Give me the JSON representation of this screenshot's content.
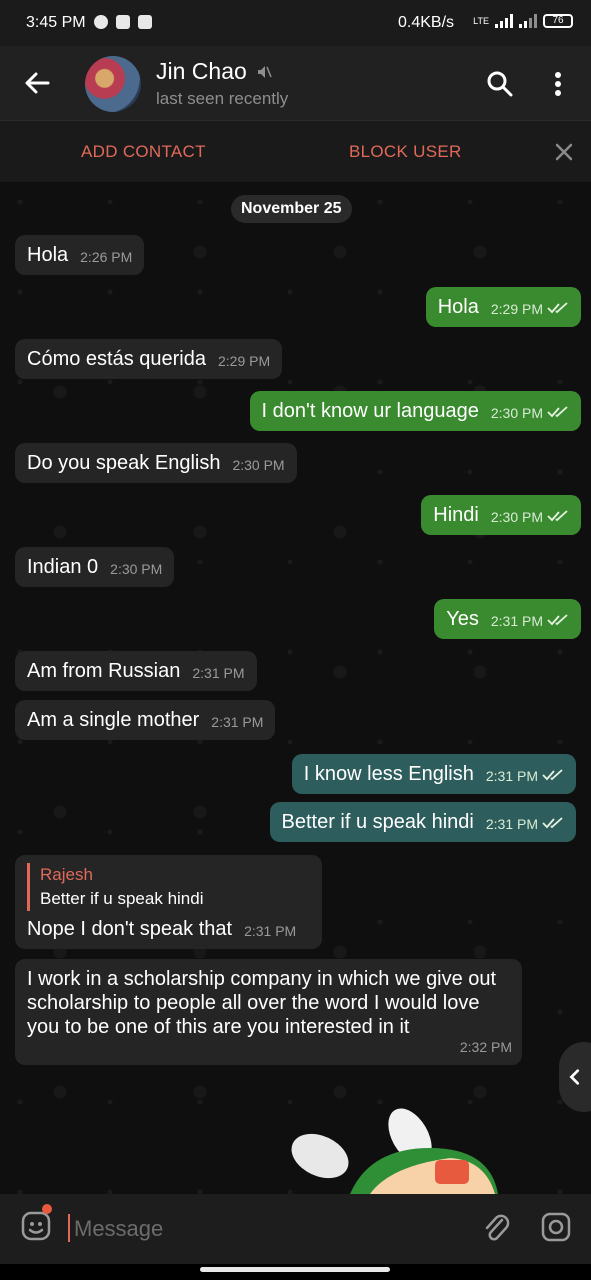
{
  "status": {
    "time": "3:45 PM",
    "net_speed": "0.4KB/s",
    "lte": "LTE",
    "battery": "76"
  },
  "header": {
    "name": "Jin Chao",
    "last_seen": "last seen recently"
  },
  "actions": {
    "add_contact": "ADD CONTACT",
    "block_user": "BLOCK USER"
  },
  "date_chip": "November 25",
  "messages": [
    {
      "dir": "in",
      "text": "Hola",
      "time": "2:26 PM"
    },
    {
      "dir": "out",
      "text": "Hola",
      "time": "2:29 PM"
    },
    {
      "dir": "in",
      "text": "Cómo estás querida",
      "time": "2:29 PM"
    },
    {
      "dir": "out",
      "text": "I don't know ur language",
      "time": "2:30 PM"
    },
    {
      "dir": "in",
      "text": "Do you speak English",
      "time": "2:30 PM"
    },
    {
      "dir": "out",
      "text": "Hindi",
      "time": "2:30 PM"
    },
    {
      "dir": "in",
      "text": "Indian 0",
      "time": "2:30 PM"
    },
    {
      "dir": "out",
      "text": "Yes",
      "time": "2:31 PM"
    },
    {
      "dir": "in",
      "text": "Am from Russian",
      "time": "2:31 PM"
    },
    {
      "dir": "in",
      "text": "Am a single mother",
      "time": "2:31 PM"
    },
    {
      "dir": "out",
      "text": "I know less English",
      "time": "2:31 PM"
    },
    {
      "dir": "out",
      "text": "Better if u speak hindi",
      "time": "2:31 PM"
    },
    {
      "dir": "in",
      "reply_name": "Rajesh",
      "reply_text": "Better if u speak hindi",
      "text": "Nope I don't speak that",
      "time": "2:31 PM"
    },
    {
      "dir": "in",
      "text": "I work in a scholarship company in which we give out scholarship to people all over the word I would love you to be one of this are you interested in it",
      "time": "2:32 PM"
    }
  ],
  "composer": {
    "placeholder": "Message"
  },
  "colors": {
    "accent": "#e0695a",
    "outgoing_green": "#3a8a2f",
    "outgoing_teal": "#2e5d5d",
    "incoming": "#252525"
  }
}
